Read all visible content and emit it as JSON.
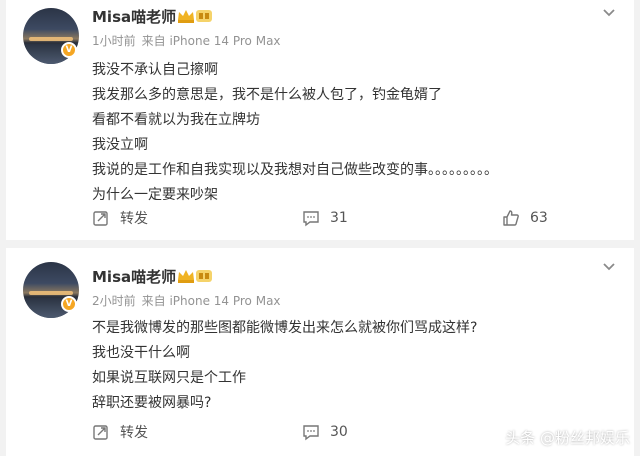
{
  "posts": [
    {
      "username": "Misa喵老师",
      "time": "1小时前",
      "source": "来自 iPhone 14 Pro Max",
      "lines": [
        "我没不承认自己擦啊",
        "我发那么多的意思是，我不是什么被人包了，钓金龟婿了",
        "看都不看就以为我在立牌坊",
        "我没立啊",
        "我说的是工作和自我实现以及我想对自己做些改变的事。。。。。。。。。",
        "为什么一定要来吵架"
      ],
      "repost_label": "转发",
      "comment_count": "31",
      "like_count": "63"
    },
    {
      "username": "Misa喵老师",
      "time": "2小时前",
      "source": "来自 iPhone 14 Pro Max",
      "lines": [
        "不是我微博发的那些图都能微博发出来怎么就被你们骂成这样?",
        "我也没干什么啊",
        "如果说互联网只是个工作",
        "辞职还要被网暴吗?"
      ],
      "repost_label": "转发",
      "comment_count": "30"
    }
  ],
  "watermark": "头条 @粉丝邦娱乐",
  "colors": {
    "badge": "#f5a623",
    "meta_text": "#939393",
    "body_text": "#333333"
  }
}
